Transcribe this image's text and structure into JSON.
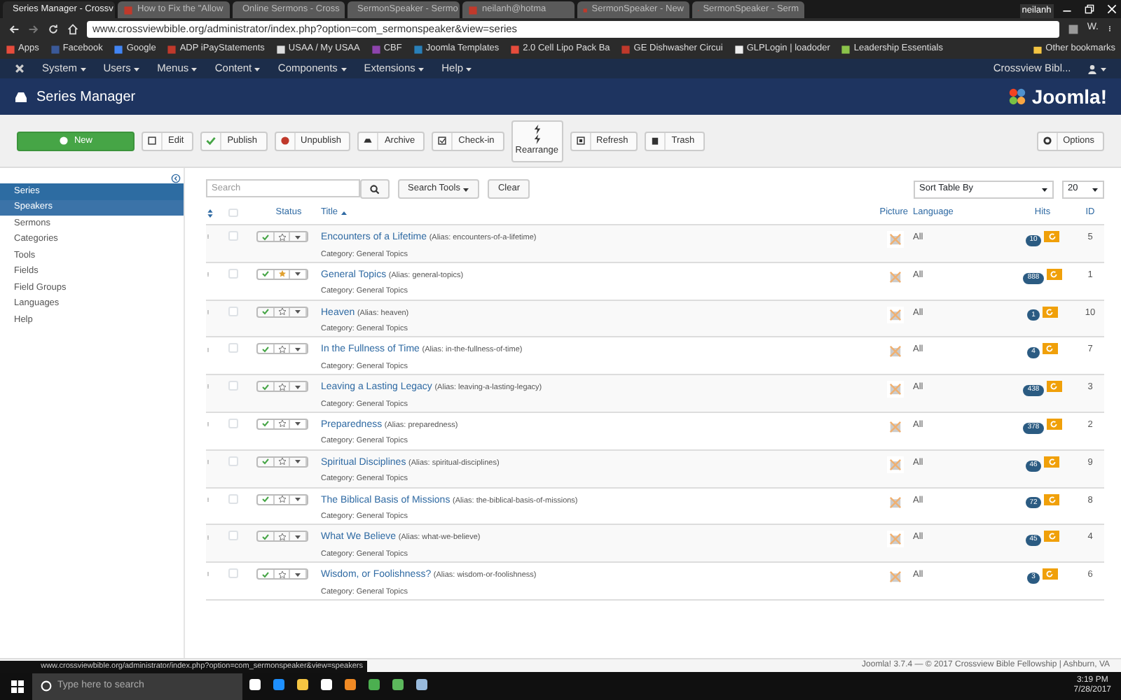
{
  "browser": {
    "tabs": [
      {
        "title": "Series Manager - Crossv",
        "selected": true
      },
      {
        "title": "How to Fix the \"Allow",
        "selected": false
      },
      {
        "title": "Online Sermons - Cross",
        "selected": false
      },
      {
        "title": "SermonSpeaker - Sermo",
        "selected": false
      },
      {
        "title": "neilanh@hotma",
        "selected": false
      },
      {
        "title": "SermonSpeaker - New",
        "selected": false
      },
      {
        "title": "SermonSpeaker - Serm",
        "selected": false
      }
    ],
    "profile": "neilanh",
    "url": "www.crossviewbible.org/administrator/index.php?option=com_sermonspeaker&view=series",
    "bookmarks": [
      "Apps",
      "Facebook",
      "Google",
      "ADP iPayStatements",
      "USAA / My USAA",
      "CBF",
      "Joomla Templates",
      "2.0 Cell Lipo Pack Ba",
      "GE Dishwasher Circui",
      "GLPLogin | loadoder",
      "Leadership Essentials"
    ],
    "other_bookmarks": "Other bookmarks",
    "extension_label": "W."
  },
  "admin_menu": {
    "items": [
      "System",
      "Users",
      "Menus",
      "Content",
      "Components",
      "Extensions",
      "Help"
    ],
    "site": "Crossview Bibl..."
  },
  "header": {
    "title": "Series Manager",
    "logo": "Joomla!"
  },
  "toolbar": {
    "buttons": [
      {
        "label": "New",
        "kind": "new"
      },
      {
        "label": "Edit",
        "kind": "edit"
      },
      {
        "label": "Publish",
        "kind": "publish"
      },
      {
        "label": "Unpublish",
        "kind": "unpublish"
      },
      {
        "label": "Archive",
        "kind": "archive"
      },
      {
        "label": "Check-in",
        "kind": "checkin"
      },
      {
        "label": "Rearrange",
        "kind": "rearrange"
      },
      {
        "label": "Refresh",
        "kind": "refresh"
      },
      {
        "label": "Trash",
        "kind": "trash"
      }
    ],
    "options": "Options"
  },
  "sidebar": {
    "items": [
      {
        "label": "Series",
        "selected": true,
        "hovered": false
      },
      {
        "label": "Speakers",
        "selected": false,
        "hovered": true
      },
      {
        "label": "Sermons",
        "selected": false,
        "hovered": false
      },
      {
        "label": "Categories",
        "selected": false,
        "hovered": false
      },
      {
        "label": "Tools",
        "selected": false,
        "hovered": false
      },
      {
        "label": "Fields",
        "selected": false,
        "hovered": false
      },
      {
        "label": "Field Groups",
        "selected": false,
        "hovered": false
      },
      {
        "label": "Languages",
        "selected": false,
        "hovered": false
      },
      {
        "label": "Help",
        "selected": false,
        "hovered": false
      }
    ]
  },
  "filters": {
    "search_placeholder": "Search",
    "search_tools": "Search Tools",
    "clear": "Clear",
    "sort": "Sort Table By",
    "limit": "20"
  },
  "table": {
    "select_all_checked": false,
    "columns": [
      "Status",
      "Title",
      "Picture",
      "Language",
      "Hits",
      "ID"
    ],
    "rows": [
      {
        "checked": false,
        "title": "Encounters of a Lifetime",
        "alias": "(Alias: encounters-of-a-lifetime)",
        "category": "Category: General Topics",
        "published": true,
        "featured": false,
        "language": "All",
        "hits": "10",
        "id": "5"
      },
      {
        "checked": false,
        "title": "General Topics",
        "alias": "(Alias: general-topics)",
        "category": "Category: General Topics",
        "published": true,
        "featured": true,
        "language": "All",
        "hits": "888",
        "id": "1"
      },
      {
        "checked": false,
        "title": "Heaven",
        "alias": "(Alias: heaven)",
        "category": "Category: General Topics",
        "published": true,
        "featured": false,
        "language": "All",
        "hits": "1",
        "id": "10"
      },
      {
        "checked": false,
        "title": "In the Fullness of Time",
        "alias": "(Alias: in-the-fullness-of-time)",
        "category": "Category: General Topics",
        "published": true,
        "featured": false,
        "language": "All",
        "hits": "4",
        "id": "7"
      },
      {
        "checked": false,
        "title": "Leaving a Lasting Legacy",
        "alias": "(Alias: leaving-a-lasting-legacy)",
        "category": "Category: General Topics",
        "published": true,
        "featured": false,
        "language": "All",
        "hits": "438",
        "id": "3"
      },
      {
        "checked": false,
        "title": "Preparedness",
        "alias": "(Alias: preparedness)",
        "category": "Category: General Topics",
        "published": true,
        "featured": false,
        "language": "All",
        "hits": "378",
        "id": "2"
      },
      {
        "checked": false,
        "title": "Spiritual Disciplines",
        "alias": "(Alias: spiritual-disciplines)",
        "category": "Category: General Topics",
        "published": true,
        "featured": false,
        "language": "All",
        "hits": "46",
        "id": "9"
      },
      {
        "checked": false,
        "title": "The Biblical Basis of Missions",
        "alias": "(Alias: the-biblical-basis-of-missions)",
        "category": "Category: General Topics",
        "published": true,
        "featured": false,
        "language": "All",
        "hits": "72",
        "id": "8"
      },
      {
        "checked": false,
        "title": "What We Believe",
        "alias": "(Alias: what-we-believe)",
        "category": "Category: General Topics",
        "published": true,
        "featured": false,
        "language": "All",
        "hits": "45",
        "id": "4"
      },
      {
        "checked": false,
        "title": "Wisdom, or Foolishness?",
        "alias": "(Alias: wisdom-or-foolishness)",
        "category": "Category: General Topics",
        "published": true,
        "featured": false,
        "language": "All",
        "hits": "3",
        "id": "6"
      }
    ]
  },
  "footer": "Joomla! 3.7.4 — © 2017 Crossview Bible Fellowship | Ashburn, VA",
  "status_link": "www.crossviewbible.org/administrator/index.php?option=com_sermonspeaker&view=speakers",
  "taskbar": {
    "search_placeholder": "Type here to search",
    "time": "3:19 PM",
    "date": "7/28/2017"
  }
}
